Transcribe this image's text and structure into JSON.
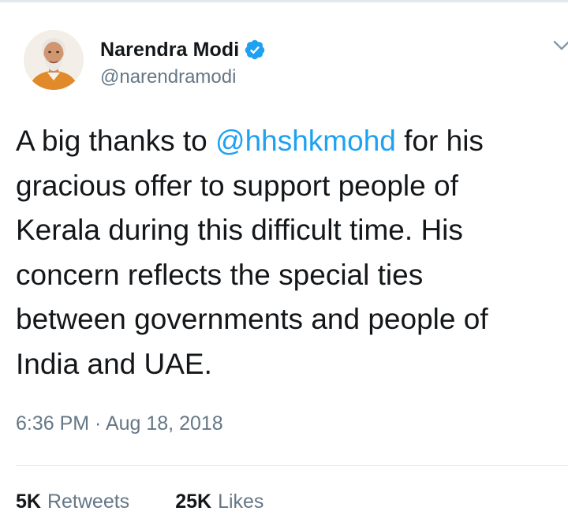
{
  "tweet": {
    "author": {
      "display_name": "Narendra Modi",
      "handle": "@narendramodi",
      "verified": true,
      "avatar_icon": "profile-photo"
    },
    "menu_icon": "chevron-down-icon",
    "text_lines": [
      {
        "before": "A big thanks to ",
        "mention": "@hhshkmohd",
        "after": " for his"
      },
      {
        "text": "gracious offer to support people of"
      },
      {
        "text": "Kerala during this difficult time. His"
      },
      {
        "text": "concern reflects the special ties"
      },
      {
        "text": "between governments and people of"
      },
      {
        "text": "India and UAE."
      }
    ],
    "timestamp": "6:36 PM · Aug 18, 2018",
    "stats": {
      "retweets_count": "5K",
      "retweets_label": "Retweets",
      "likes_count": "25K",
      "likes_label": "Likes"
    }
  },
  "colors": {
    "link": "#1da1f2",
    "text": "#14171a",
    "secondary": "#657786",
    "border": "#e1e8ed"
  }
}
